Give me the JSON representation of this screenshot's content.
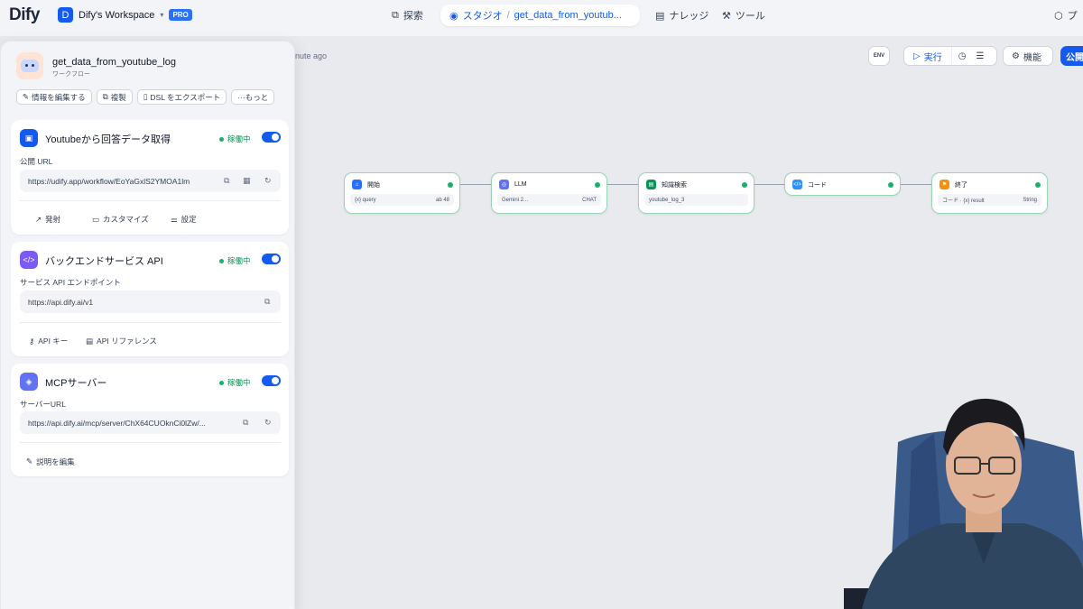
{
  "topbar": {
    "logo": "Dify",
    "workspace_initial": "D",
    "workspace_name": "Dify's Workspace",
    "workspace_badge": "PRO",
    "explore": "探索",
    "studio": "スタジオ",
    "current_app": "get_data_from_youtub...",
    "knowledge": "ナレッジ",
    "tools": "ツール",
    "more": "プ"
  },
  "canvas": {
    "saved_ago": "nute ago",
    "env_label": "ENV",
    "run_label": "実行",
    "features_label": "機能",
    "publish_label": "公開",
    "nodes": [
      {
        "title": "開始",
        "icon": "home-icon",
        "color": "#2970ff",
        "row_left": "{x} query",
        "row_right": "ab 48"
      },
      {
        "title": "LLM",
        "icon": "llm-icon",
        "color": "#6172f3",
        "row_left": "Gemini 2...",
        "row_right": "CHAT"
      },
      {
        "title": "知識検索",
        "icon": "book-icon",
        "color": "#079455",
        "row_left": "youtube_log_3",
        "row_right": ""
      },
      {
        "title": "コード",
        "icon": "code-icon",
        "color": "#2e90fa",
        "row_left": "",
        "row_right": ""
      },
      {
        "title": "終了",
        "icon": "flag-icon",
        "color": "#f79009",
        "row_left": "コード · {x} result",
        "row_right": "String"
      }
    ]
  },
  "panel": {
    "app_name": "get_data_from_youtube_log",
    "app_type": "ワークフロー",
    "buttons": [
      "情報を編集する",
      "複製",
      "DSL をエクスポート",
      "···もっと"
    ],
    "webapp": {
      "title": "Youtubeから回答データ取得",
      "status": "稼働中",
      "url_label": "公開 URL",
      "url": "https://udify.app/workflow/EoYaGxlS2YMOA1lm",
      "actions": [
        "発射",
        "カスタマイズ",
        "設定"
      ]
    },
    "backend": {
      "title": "バックエンドサービス API",
      "status": "稼働中",
      "url_label": "サービス API エンドポイント",
      "url": "https://api.dify.ai/v1",
      "actions": [
        "API キー",
        "API リファレンス"
      ]
    },
    "mcp": {
      "title": "MCPサーバー",
      "status": "稼働中",
      "url_label": "サーバーURL",
      "url": "https://api.dify.ai/mcp/server/ChX64CUOknCi0lZw/...",
      "edit_desc": "説明を編集"
    }
  }
}
